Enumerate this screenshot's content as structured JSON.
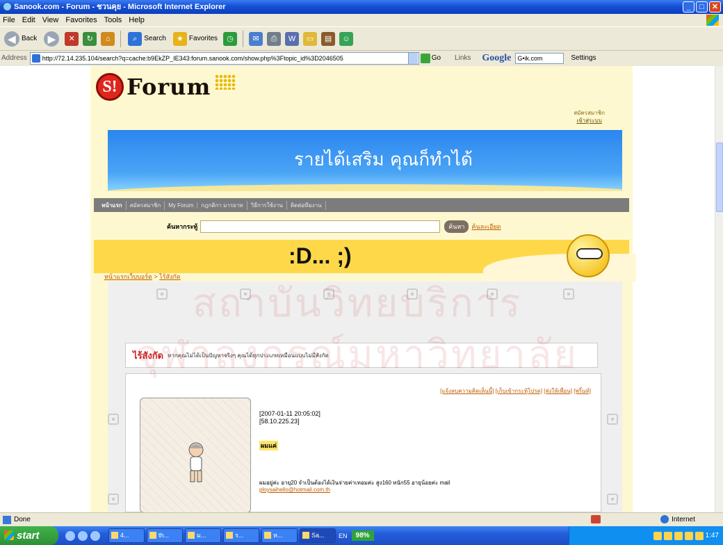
{
  "window": {
    "title": "Sanook.com - Forum - ชวนคุย - Microsoft Internet Explorer"
  },
  "menu": [
    "File",
    "Edit",
    "View",
    "Favorites",
    "Tools",
    "Help"
  ],
  "toolbar": {
    "back": "Back",
    "search": "Search",
    "favorites": "Favorites"
  },
  "address": {
    "label": "Address",
    "url": "http://72.14.235.104/search?q=cache:b9EkZP_IE343:forum.sanook.com/show.php%3Ftopic_id%3D2046505",
    "go": "Go",
    "links": "Links",
    "google_logo": "Google",
    "google_box": "G•ik.com",
    "settings": "Settings"
  },
  "page": {
    "logo_mark": "S!",
    "logo_word": "Forum",
    "member_link_1": "สมัครสมาชิก",
    "member_link_2": "เข้าสู่ระบบ",
    "banner_text": "รายได้เสริม คุณก็ทำได้",
    "nav": [
      "หน้าแรก",
      "สมัครสมาชิก",
      "My Forum",
      "กฎกติกา มารยาท",
      "วิธีการใช้งาน",
      "ติดต่อทีมงาน"
    ],
    "search_label": "ค้นหากระทู้",
    "search_button": "ค้นหา",
    "search_advanced": "ค้นละเอียด",
    "emoticon_text": ":D... ;)",
    "breadcrumb_home": "หน้าแรกเว็บบอร์ด",
    "breadcrumb_sep": ">",
    "breadcrumb_current": "ไร้สังกัด",
    "tip_heading": "ไร้สังกัด",
    "tip_text": "หากคุณไม่ได้เป็นปัญหาจริงๆ คุณได้ทุกประเภทเหมือนแบบไม่มีสังกัด",
    "post_links": [
      "[แจ้งลบความคิดเห็นนี้]",
      "[เก็บเข้ากระทู้โปรด]",
      "[ส่งให้เพื่อน]",
      "[พริ้นท์]"
    ],
    "post_date": "[2007-01-11 20:05:02]",
    "post_ip": "[58.10.225.23]",
    "poster": "ผมแค่",
    "post_body": "ผมอยู่ค่ะ อายุ20 จำเป็นต้องได้เงินจ่ายค่าเทอมค่ะ สูง160 หนัก55 อายุน้อยค่ะ mail",
    "post_email": "ploysaihello@hotmail.com.th",
    "watermark_1": "สถาบันวิทยบริการ",
    "watermark_2": "จุฬาลงกรณ์มหาวิทยาลัย"
  },
  "status": {
    "text": "Done",
    "zone": "Internet"
  },
  "taskbar": {
    "start": "start",
    "tasks": [
      "4...",
      "th...",
      "ม...",
      "ร...",
      "ห...",
      "Sa..."
    ],
    "lang": "EN",
    "battery": "98%",
    "clock": "1:47"
  }
}
